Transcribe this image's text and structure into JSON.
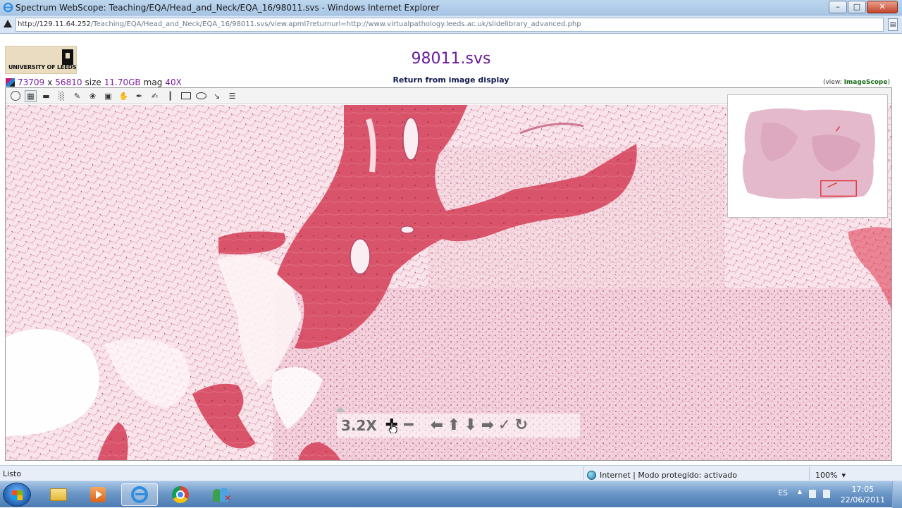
{
  "window": {
    "title": "Spectrum WebScope: Teaching/EQA/Head_and_Neck/EQA_16/98011.svs - Windows Internet Explorer",
    "url_host": "http://129.11.64.252",
    "url_rest": "/Teaching/EQA/Head_and_Neck/EQA_16/98011.svs/view.apml?returnurl=http://www.virtualpathology.leeds.ac.uk/slidelibrary_advanced.php",
    "buttons": {
      "minimize": "–",
      "maximize": "□",
      "close": "✕"
    }
  },
  "page": {
    "logo_text": "UNIVERSITY OF LEEDS",
    "title": "98011.svs",
    "return_link": "Return from image display",
    "view_prefix": "(view: ",
    "view_link": "ImageScope",
    "view_suffix": ")",
    "info": {
      "width": "73709",
      "x": "x",
      "height": "56810",
      "size_label": "size",
      "size": "11.70GB",
      "mag_label": "mag",
      "mag": "40X"
    }
  },
  "toolbar": {
    "tools": [
      {
        "name": "navigate-tool-icon",
        "glyph": ""
      },
      {
        "name": "thumbnail-tool-icon",
        "glyph": "▦"
      },
      {
        "name": "slide-label-tool-icon",
        "glyph": "▬"
      },
      {
        "name": "annotation-tool-icon",
        "glyph": "░"
      },
      {
        "name": "edit-tool-icon",
        "glyph": "✎"
      },
      {
        "name": "color-tool-icon",
        "glyph": "❀"
      },
      {
        "name": "save-tool-icon",
        "glyph": "▣"
      },
      {
        "name": "hand-tool-icon",
        "glyph": "✋"
      },
      {
        "name": "pen-tool-icon",
        "glyph": "✒"
      },
      {
        "name": "freehand-tool-icon",
        "glyph": "✍"
      },
      {
        "name": "ruler-tool-icon",
        "glyph": "┃"
      },
      {
        "name": "rectangle-tool-icon",
        "glyph": ""
      },
      {
        "name": "ellipse-tool-icon",
        "glyph": ""
      },
      {
        "name": "arrow-tool-icon",
        "glyph": "↘"
      },
      {
        "name": "list-tool-icon",
        "glyph": "☰"
      }
    ]
  },
  "viewer": {
    "zoom_level": "3.2X",
    "zoom_in": "✚",
    "zoom_out": "━",
    "pan_left": "⬅",
    "pan_up": "⬆",
    "pan_down": "⬇",
    "pan_right": "➡",
    "apply": "✓",
    "reset": "↻",
    "colors": {
      "bone": "#d8485f",
      "tissue": "#f2c7d1",
      "background": "#fbf4f6"
    }
  },
  "statusbar": {
    "ready": "Listo",
    "zone": "Internet | Modo protegido: activado",
    "zoom": "100%",
    "zoom_caret": "▾"
  },
  "taskbar": {
    "lang": "ES",
    "tray_caret": "▲",
    "time": "17:05",
    "date": "22/06/2011"
  }
}
